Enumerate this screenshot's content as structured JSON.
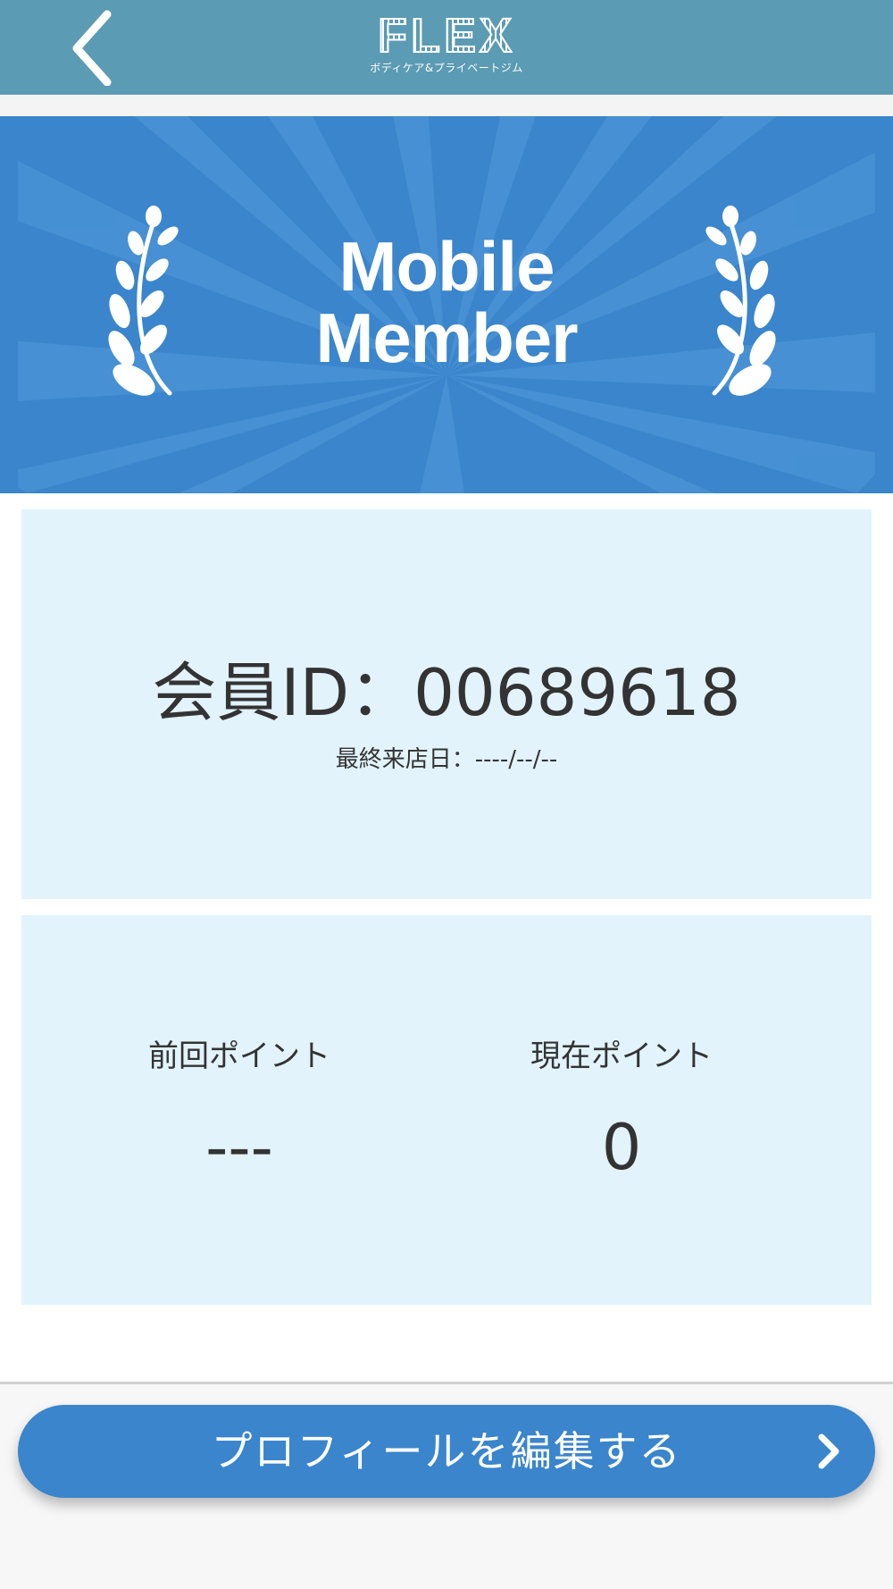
{
  "header": {
    "logo_text": "FLEX",
    "logo_subtitle": "ボディケア&プライベートジム",
    "back_icon": "chevron-left-icon"
  },
  "banner": {
    "line1": "Mobile",
    "line2": "Member",
    "decoration_icon": "laurel-icon"
  },
  "member": {
    "id_text": "会員ID：00689618",
    "last_visit_text": "最終来店日：----/--/--"
  },
  "points": {
    "previous_label": "前回ポイント",
    "previous_value": "---",
    "current_label": "現在ポイント",
    "current_value": "0"
  },
  "actions": {
    "edit_profile_label": "プロフィールを編集する",
    "edit_profile_icon": "chevron-right-icon"
  },
  "colors": {
    "header_bg": "#5b9bb3",
    "banner_bg": "#3a85cc",
    "card_bg": "#e2f3fc",
    "button_bg": "#3a85cc",
    "text": "#333333"
  }
}
